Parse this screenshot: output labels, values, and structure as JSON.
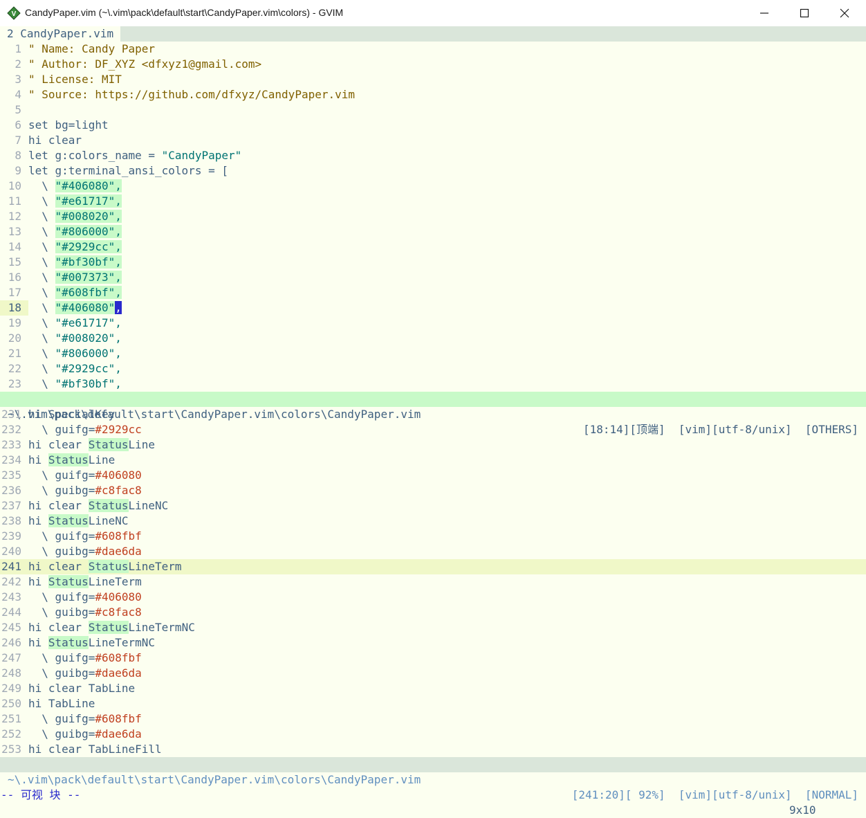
{
  "window": {
    "title": "CandyPaper.vim (~\\.vim\\pack\\default\\start\\CandyPaper.vim\\colors) - GVIM",
    "app_icon": "vim-icon"
  },
  "tabline": {
    "active_tab": "2 CandyPaper.vim"
  },
  "colors": {
    "background": "#fcfff0",
    "statusline_bg": "#c8fac8",
    "statusline_nc_bg": "#dae6da",
    "text": "#406080"
  },
  "top_pane": {
    "lines": [
      {
        "n": "1",
        "segs": [
          [
            "cmt",
            "\" Name: Candy Paper"
          ]
        ]
      },
      {
        "n": "2",
        "segs": [
          [
            "cmt",
            "\" Author: DF_XYZ <dfxyz1@gmail.com>"
          ]
        ]
      },
      {
        "n": "3",
        "segs": [
          [
            "cmt",
            "\" License: MIT"
          ]
        ]
      },
      {
        "n": "4",
        "segs": [
          [
            "cmt",
            "\" Source: https://github.com/dfxyz/CandyPaper.vim"
          ]
        ]
      },
      {
        "n": "5",
        "segs": []
      },
      {
        "n": "6",
        "segs": [
          [
            "kw",
            "set bg=light"
          ]
        ]
      },
      {
        "n": "7",
        "segs": [
          [
            "kw",
            "hi clear"
          ]
        ]
      },
      {
        "n": "8",
        "segs": [
          [
            "kw",
            "let g:colors_name = "
          ],
          [
            "str",
            "\"CandyPaper\""
          ]
        ]
      },
      {
        "n": "9",
        "segs": [
          [
            "kw",
            "let g:terminal_ansi_colors = ["
          ]
        ]
      },
      {
        "n": "10",
        "segs": [
          [
            "kw",
            "  \\ "
          ],
          [
            "str vsel",
            "\"#406080\","
          ]
        ]
      },
      {
        "n": "11",
        "segs": [
          [
            "kw",
            "  \\ "
          ],
          [
            "str vsel",
            "\"#e61717\","
          ]
        ]
      },
      {
        "n": "12",
        "segs": [
          [
            "kw",
            "  \\ "
          ],
          [
            "str vsel",
            "\"#008020\","
          ]
        ]
      },
      {
        "n": "13",
        "segs": [
          [
            "kw",
            "  \\ "
          ],
          [
            "str vsel",
            "\"#806000\","
          ]
        ]
      },
      {
        "n": "14",
        "segs": [
          [
            "kw",
            "  \\ "
          ],
          [
            "str vsel",
            "\"#2929cc\","
          ]
        ]
      },
      {
        "n": "15",
        "segs": [
          [
            "kw",
            "  \\ "
          ],
          [
            "str vsel",
            "\"#bf30bf\","
          ]
        ]
      },
      {
        "n": "16",
        "segs": [
          [
            "kw",
            "  \\ "
          ],
          [
            "str vsel",
            "\"#007373\","
          ]
        ]
      },
      {
        "n": "17",
        "segs": [
          [
            "kw",
            "  \\ "
          ],
          [
            "str vsel",
            "\"#608fbf\","
          ]
        ]
      },
      {
        "n": "18",
        "cur": true,
        "segs": [
          [
            "kw",
            "  \\ "
          ],
          [
            "str vsel",
            "\"#406080\""
          ],
          [
            "cursor",
            ","
          ]
        ]
      },
      {
        "n": "19",
        "segs": [
          [
            "kw",
            "  \\ "
          ],
          [
            "str",
            "\"#e61717\","
          ]
        ]
      },
      {
        "n": "20",
        "segs": [
          [
            "kw",
            "  \\ "
          ],
          [
            "str",
            "\"#008020\","
          ]
        ]
      },
      {
        "n": "21",
        "segs": [
          [
            "kw",
            "  \\ "
          ],
          [
            "str",
            "\"#806000\","
          ]
        ]
      },
      {
        "n": "22",
        "segs": [
          [
            "kw",
            "  \\ "
          ],
          [
            "str",
            "\"#2929cc\","
          ]
        ]
      },
      {
        "n": "23",
        "segs": [
          [
            "kw",
            "  \\ "
          ],
          [
            "str",
            "\"#bf30bf\","
          ]
        ]
      }
    ],
    "status": {
      "path": "~\\.vim\\pack\\default\\start\\CandyPaper.vim\\colors\\CandyPaper.vim",
      "info": "[18:14][顶端]  [vim][utf-8/unix]  [OTHERS]"
    }
  },
  "bottom_pane": {
    "lines": [
      {
        "n": "231",
        "segs": [
          [
            "kw",
            "hi SpecialKey"
          ]
        ]
      },
      {
        "n": "232",
        "segs": [
          [
            "kw",
            "  \\ guifg="
          ],
          [
            "num",
            "#2929cc"
          ]
        ]
      },
      {
        "n": "233",
        "segs": [
          [
            "kw",
            "hi clear "
          ],
          [
            "srch",
            "Status"
          ],
          [
            "kw",
            "Line"
          ]
        ]
      },
      {
        "n": "234",
        "segs": [
          [
            "kw",
            "hi "
          ],
          [
            "srch",
            "Status"
          ],
          [
            "kw",
            "Line"
          ]
        ]
      },
      {
        "n": "235",
        "segs": [
          [
            "kw",
            "  \\ guifg="
          ],
          [
            "num",
            "#406080"
          ]
        ]
      },
      {
        "n": "236",
        "segs": [
          [
            "kw",
            "  \\ guibg="
          ],
          [
            "num",
            "#c8fac8"
          ]
        ]
      },
      {
        "n": "237",
        "segs": [
          [
            "kw",
            "hi clear "
          ],
          [
            "srch",
            "Status"
          ],
          [
            "kw",
            "LineNC"
          ]
        ]
      },
      {
        "n": "238",
        "segs": [
          [
            "kw",
            "hi "
          ],
          [
            "srch",
            "Status"
          ],
          [
            "kw",
            "LineNC"
          ]
        ]
      },
      {
        "n": "239",
        "segs": [
          [
            "kw",
            "  \\ guifg="
          ],
          [
            "num",
            "#608fbf"
          ]
        ]
      },
      {
        "n": "240",
        "segs": [
          [
            "kw",
            "  \\ guibg="
          ],
          [
            "num",
            "#dae6da"
          ]
        ]
      },
      {
        "n": "241",
        "cur": true,
        "segs": [
          [
            "kw",
            "hi clear "
          ],
          [
            "srch",
            "Status"
          ],
          [
            "kw",
            "LineTerm"
          ]
        ]
      },
      {
        "n": "242",
        "segs": [
          [
            "kw",
            "hi "
          ],
          [
            "srch",
            "Status"
          ],
          [
            "kw",
            "LineTerm"
          ]
        ]
      },
      {
        "n": "243",
        "segs": [
          [
            "kw",
            "  \\ guifg="
          ],
          [
            "num",
            "#406080"
          ]
        ]
      },
      {
        "n": "244",
        "segs": [
          [
            "kw",
            "  \\ guibg="
          ],
          [
            "num",
            "#c8fac8"
          ]
        ]
      },
      {
        "n": "245",
        "segs": [
          [
            "kw",
            "hi clear "
          ],
          [
            "srch",
            "Status"
          ],
          [
            "kw",
            "LineTermNC"
          ]
        ]
      },
      {
        "n": "246",
        "segs": [
          [
            "kw",
            "hi "
          ],
          [
            "srch",
            "Status"
          ],
          [
            "kw",
            "LineTermNC"
          ]
        ]
      },
      {
        "n": "247",
        "segs": [
          [
            "kw",
            "  \\ guifg="
          ],
          [
            "num",
            "#608fbf"
          ]
        ]
      },
      {
        "n": "248",
        "segs": [
          [
            "kw",
            "  \\ guibg="
          ],
          [
            "num",
            "#dae6da"
          ]
        ]
      },
      {
        "n": "249",
        "segs": [
          [
            "kw",
            "hi clear TabLine"
          ]
        ]
      },
      {
        "n": "250",
        "segs": [
          [
            "kw",
            "hi TabLine"
          ]
        ]
      },
      {
        "n": "251",
        "segs": [
          [
            "kw",
            "  \\ guifg="
          ],
          [
            "num",
            "#608fbf"
          ]
        ]
      },
      {
        "n": "252",
        "segs": [
          [
            "kw",
            "  \\ guibg="
          ],
          [
            "num",
            "#dae6da"
          ]
        ]
      },
      {
        "n": "253",
        "segs": [
          [
            "kw",
            "hi clear TabLineFill"
          ]
        ]
      }
    ],
    "status": {
      "path": "~\\.vim\\pack\\default\\start\\CandyPaper.vim\\colors\\CandyPaper.vim",
      "info": "[241:20][ 92%]  [vim][utf-8/unix]  [NORMAL]"
    }
  },
  "cmdline": {
    "mode": "-- 可视 块 --",
    "selection_size": "9x10"
  }
}
